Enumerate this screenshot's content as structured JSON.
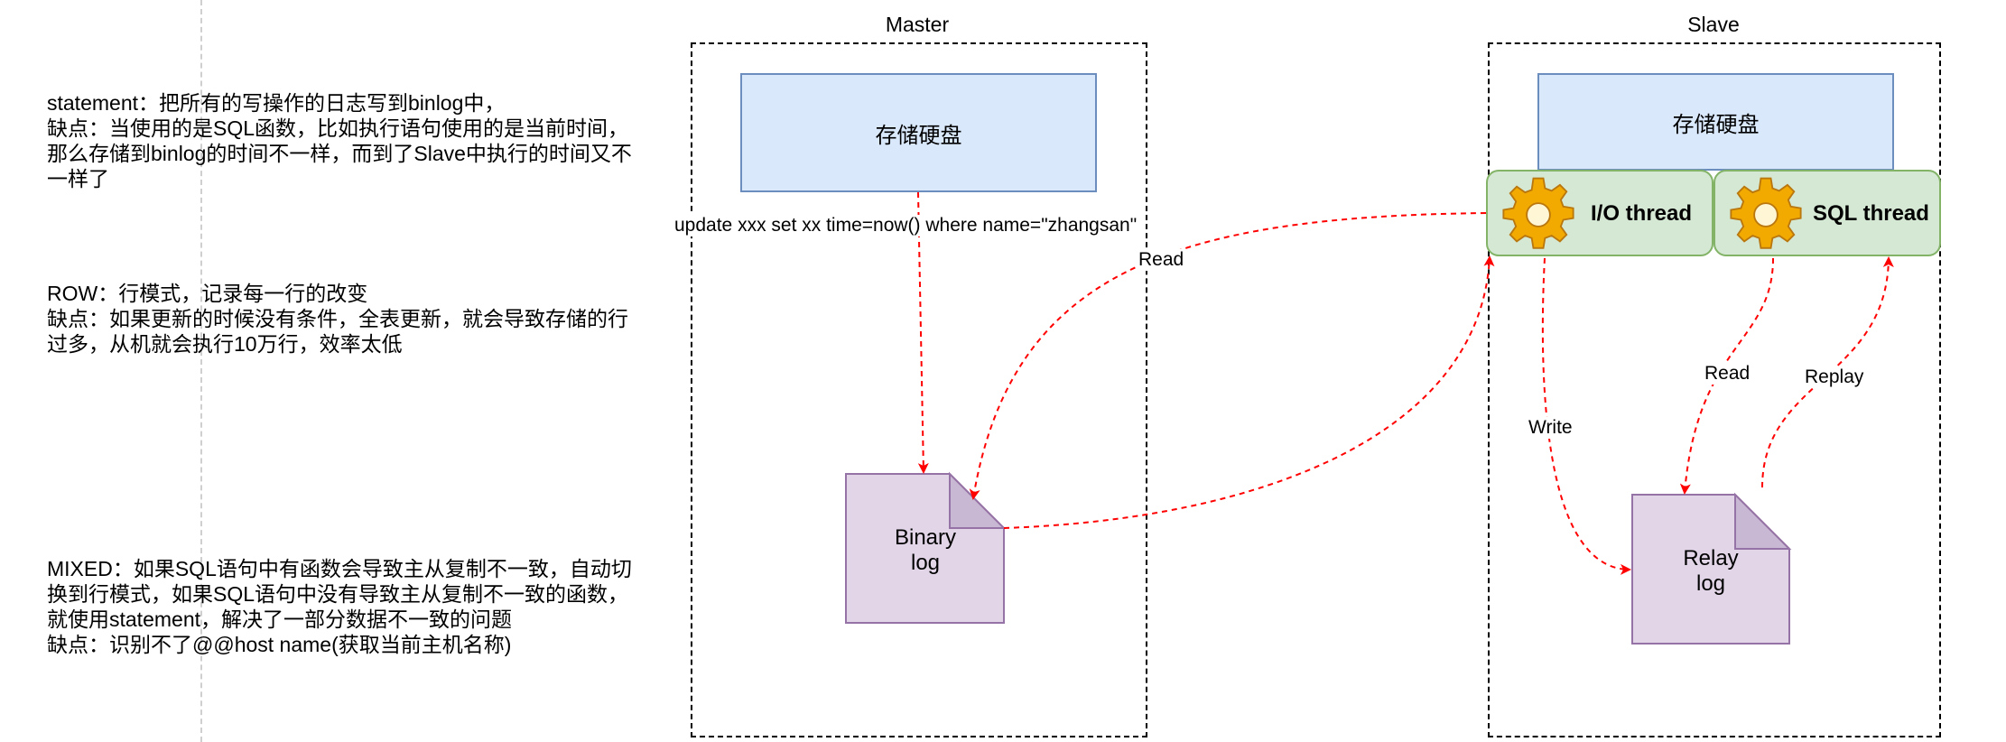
{
  "notes": {
    "statement": "statement：把所有的写操作的日志写到binlog中，\n缺点：当使用的是SQL函数，比如执行语句使用的是当前时间，那么存储到binlog的时间不一样，而到了Slave中执行的时间又不一样了",
    "row": "ROW：行模式，记录每一行的改变\n缺点：如果更新的时候没有条件，全表更新，就会导致存储的行过多，从机就会执行10万行，效率太低",
    "mixed": "MIXED：如果SQL语句中有函数会导致主从复制不一致，自动切换到行模式，如果SQL语句中没有导致主从复制不一致的函数，就使用statement，解决了一部分数据不一致的问题\n缺点：识别不了@@host name(获取当前主机名称)"
  },
  "master": {
    "title": "Master",
    "disk_label": "存储硬盘",
    "sql_label": "update xxx set xx time=now() where name=\"zhangsan\"",
    "binlog_label_line1": "Binary",
    "binlog_label_line2": "log"
  },
  "slave": {
    "title": "Slave",
    "disk_label": "存储硬盘",
    "io_thread_label": "I/O thread",
    "sql_thread_label": "SQL thread",
    "relay_label_line1": "Relay",
    "relay_label_line2": "log"
  },
  "edges": {
    "read_master": "Read",
    "write": "Write",
    "read_relay": "Read",
    "replay": "Replay"
  },
  "colors": {
    "disk_fill": "#dae8fc",
    "disk_stroke": "#6c8ebf",
    "thread_fill": "#d5e8d4",
    "thread_stroke": "#82b366",
    "log_fill": "#e1d5e7",
    "log_stroke": "#9673a6",
    "arrow": "#ff0000",
    "gear": "#f2a900"
  },
  "icons": {
    "thread_icon": "gear-icon"
  }
}
